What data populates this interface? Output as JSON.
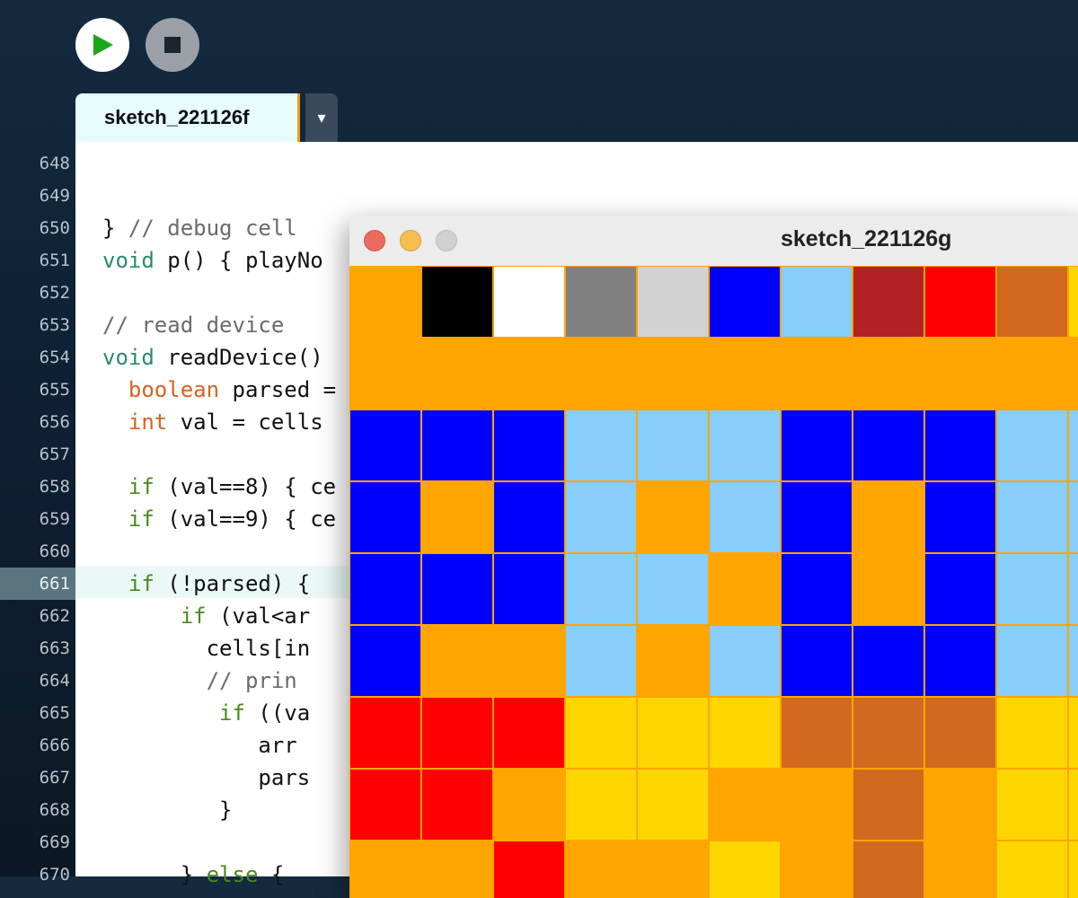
{
  "toolbar": {
    "run_icon": "play-icon",
    "stop_icon": "stop-icon",
    "run_color": "#1aa81a"
  },
  "tab": {
    "label": "sketch_221126f",
    "dropdown_glyph": "▾"
  },
  "editor": {
    "active_line": 661,
    "lines": [
      {
        "n": 648,
        "segments": []
      },
      {
        "n": 649,
        "segments": []
      },
      {
        "n": 650,
        "segments": [
          {
            "t": "} "
          },
          {
            "t": "// debug cell",
            "c": "cm"
          }
        ]
      },
      {
        "n": 651,
        "segments": [
          {
            "t": "void",
            "c": "kw-teal"
          },
          {
            "t": " p() { playNo"
          }
        ]
      },
      {
        "n": 652,
        "segments": []
      },
      {
        "n": 653,
        "segments": [
          {
            "t": "// read device",
            "c": "cm"
          }
        ]
      },
      {
        "n": 654,
        "segments": [
          {
            "t": "void",
            "c": "kw-teal"
          },
          {
            "t": " readDevice()"
          }
        ]
      },
      {
        "n": 655,
        "segments": [
          {
            "t": "  "
          },
          {
            "t": "boolean",
            "c": "kw-orange"
          },
          {
            "t": " parsed ="
          }
        ]
      },
      {
        "n": 656,
        "segments": [
          {
            "t": "  "
          },
          {
            "t": "int",
            "c": "kw-orange"
          },
          {
            "t": " val = cells"
          }
        ]
      },
      {
        "n": 657,
        "segments": []
      },
      {
        "n": 658,
        "segments": [
          {
            "t": "  "
          },
          {
            "t": "if",
            "c": "kw-green"
          },
          {
            "t": " (val==8) { ce"
          }
        ]
      },
      {
        "n": 659,
        "segments": [
          {
            "t": "  "
          },
          {
            "t": "if",
            "c": "kw-green"
          },
          {
            "t": " (val==9) { ce"
          }
        ]
      },
      {
        "n": 660,
        "segments": []
      },
      {
        "n": 661,
        "segments": [
          {
            "t": "  "
          },
          {
            "t": "if",
            "c": "kw-green"
          },
          {
            "t": " (!parsed) {"
          }
        ]
      },
      {
        "n": 662,
        "segments": [
          {
            "t": "      "
          },
          {
            "t": "if",
            "c": "kw-green"
          },
          {
            "t": " (val<ar"
          }
        ]
      },
      {
        "n": 663,
        "segments": [
          {
            "t": "        cells[in"
          }
        ]
      },
      {
        "n": 664,
        "segments": [
          {
            "t": "        "
          },
          {
            "t": "// prin",
            "c": "cm"
          }
        ]
      },
      {
        "n": 665,
        "segments": [
          {
            "t": "         "
          },
          {
            "t": "if",
            "c": "kw-green"
          },
          {
            "t": " ((va"
          }
        ]
      },
      {
        "n": 666,
        "segments": [
          {
            "t": "            arr"
          }
        ]
      },
      {
        "n": 667,
        "segments": [
          {
            "t": "            pars"
          }
        ]
      },
      {
        "n": 668,
        "segments": [
          {
            "t": "         }"
          }
        ]
      },
      {
        "n": 669,
        "segments": []
      },
      {
        "n": 670,
        "segments": [
          {
            "t": "      } "
          },
          {
            "t": "else",
            "c": "kw-green"
          },
          {
            "t": " {"
          }
        ]
      }
    ]
  },
  "sketch_window": {
    "title": "sketch_221126g",
    "background": "#ffa500",
    "palette": {
      "O": "#ffa500",
      "K": "#000000",
      "W": "#ffffff",
      "G": "#808080",
      "L": "#d3d3d3",
      "B": "#0000ff",
      "S": "#87cefa",
      "R": "#b22222",
      "E": "#ff0000",
      "C": "#d2691e",
      "Y": "#ffd700"
    },
    "grid": [
      "OKWGLBSRECY",
      "OOOOOOOOOOO",
      "BBBSSSBBBSS",
      "BOBSOSBOBSS",
      "BBBSSOBOBSS",
      "BOOSOSBBBSS",
      "EEEYYYCCCYY",
      "EEOYYOOCOYY",
      "OOEOOYOCOYY"
    ]
  }
}
